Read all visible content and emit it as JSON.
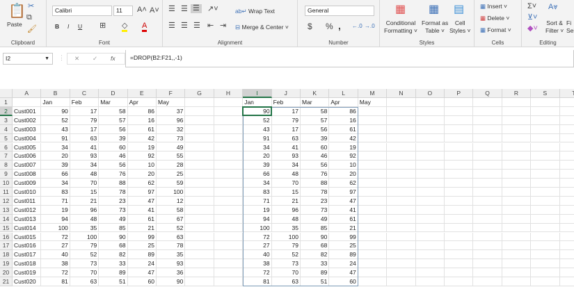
{
  "ribbon": {
    "clipboard": {
      "label": "Clipboard",
      "paste": "Paste"
    },
    "font": {
      "label": "Font",
      "name": "Calibri",
      "size": "11",
      "bold": "B",
      "italic": "I",
      "underline": "U"
    },
    "alignment": {
      "label": "Alignment",
      "wrap": "Wrap Text",
      "merge": "Merge & Center"
    },
    "number": {
      "label": "Number",
      "format": "General",
      "currency": "$",
      "percent": "%",
      "comma": ","
    },
    "styles": {
      "label": "Styles",
      "conditional": [
        "Conditional",
        "Formatting ˅"
      ],
      "table": [
        "Format as",
        "Table ˅"
      ],
      "cell": [
        "Cell",
        "Styles ˅"
      ]
    },
    "cells": {
      "label": "Cells",
      "insert": "Insert",
      "delete": "Delete",
      "format": "Format"
    },
    "editing": {
      "label": "Editing",
      "sort": [
        "Sort &",
        "Filter ˅"
      ],
      "find": [
        "Fi",
        "Sel"
      ]
    }
  },
  "formula_bar": {
    "name_box": "I2",
    "formula": "=DROP(B2:F21,,-1)"
  },
  "columns": [
    "A",
    "B",
    "C",
    "D",
    "E",
    "F",
    "G",
    "H",
    "I",
    "J",
    "K",
    "L",
    "M",
    "N",
    "O",
    "P",
    "Q",
    "R",
    "S",
    "T"
  ],
  "selected_cell": "I2",
  "source": {
    "headers": [
      "",
      "Jan",
      "Feb",
      "Mar",
      "Apr",
      "May"
    ],
    "rows": [
      [
        "Cust001",
        90,
        17,
        58,
        86,
        37
      ],
      [
        "Cust002",
        52,
        79,
        57,
        16,
        96
      ],
      [
        "Cust003",
        43,
        17,
        56,
        61,
        32
      ],
      [
        "Cust004",
        91,
        63,
        39,
        42,
        73
      ],
      [
        "Cust005",
        34,
        41,
        60,
        19,
        49
      ],
      [
        "Cust006",
        20,
        93,
        46,
        92,
        55
      ],
      [
        "Cust007",
        39,
        34,
        56,
        10,
        28
      ],
      [
        "Cust008",
        66,
        48,
        76,
        20,
        25
      ],
      [
        "Cust009",
        34,
        70,
        88,
        62,
        59
      ],
      [
        "Cust010",
        83,
        15,
        78,
        97,
        100
      ],
      [
        "Cust011",
        71,
        21,
        23,
        47,
        12
      ],
      [
        "Cust012",
        19,
        96,
        73,
        41,
        58
      ],
      [
        "Cust013",
        94,
        48,
        49,
        61,
        67
      ],
      [
        "Cust014",
        100,
        35,
        85,
        21,
        52
      ],
      [
        "Cust015",
        72,
        100,
        90,
        99,
        63
      ],
      [
        "Cust016",
        27,
        79,
        68,
        25,
        78
      ],
      [
        "Cust017",
        40,
        52,
        82,
        89,
        35
      ],
      [
        "Cust018",
        38,
        73,
        33,
        24,
        93
      ],
      [
        "Cust019",
        72,
        70,
        89,
        47,
        36
      ],
      [
        "Cust020",
        81,
        63,
        51,
        60,
        90
      ]
    ]
  },
  "result": {
    "headers": [
      "Jan",
      "Feb",
      "Mar",
      "Apr",
      "May"
    ],
    "rows": [
      [
        90,
        17,
        58,
        86
      ],
      [
        52,
        79,
        57,
        16
      ],
      [
        43,
        17,
        56,
        61
      ],
      [
        91,
        63,
        39,
        42
      ],
      [
        34,
        41,
        60,
        19
      ],
      [
        20,
        93,
        46,
        92
      ],
      [
        39,
        34,
        56,
        10
      ],
      [
        66,
        48,
        76,
        20
      ],
      [
        34,
        70,
        88,
        62
      ],
      [
        83,
        15,
        78,
        97
      ],
      [
        71,
        21,
        23,
        47
      ],
      [
        19,
        96,
        73,
        41
      ],
      [
        94,
        48,
        49,
        61
      ],
      [
        100,
        35,
        85,
        21
      ],
      [
        72,
        100,
        90,
        99
      ],
      [
        27,
        79,
        68,
        25
      ],
      [
        40,
        52,
        82,
        89
      ],
      [
        38,
        73,
        33,
        24
      ],
      [
        72,
        70,
        89,
        47
      ],
      [
        81,
        63,
        51,
        60
      ]
    ]
  },
  "colors": {
    "accent": "#217346",
    "selection_border": "#7f9db9"
  }
}
